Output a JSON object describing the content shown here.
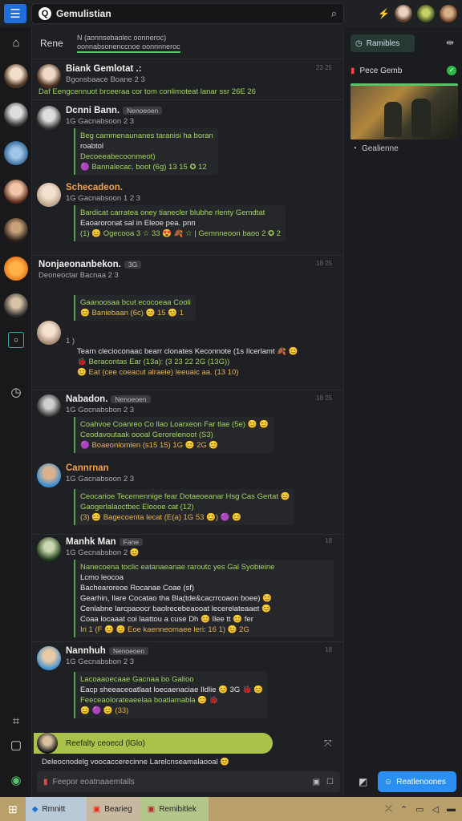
{
  "app": {
    "title": "Gemulistian"
  },
  "topbar": {
    "search_text": "Gemulistian",
    "right_glyph": "⚡"
  },
  "channel": {
    "label": "Rene",
    "crumb_line1": "N (aonnsebaolec oonneroc)",
    "crumb_line2": "oonnabsonenccnoe oonnnneroc"
  },
  "messages": [
    {
      "name": "Biank Gemlotat .:",
      "status": "Bgonsbaace Boane 2 3",
      "time": "23 25",
      "lines": [
        "Daf  Eengcennuot brceeraa cor tom conlimoteat lanar ssr 26E  26"
      ]
    },
    {
      "name": "Dcnni Bann.",
      "tag": "Nenoeoen",
      "status": "1G Gacnabsoon 2 3",
      "time": "",
      "lines": [
        "Beg cammenaunanes taranisi ha boran",
        "roabtol",
        "Decoeeabecoonmeot)",
        "🟣 Bannalecac, boot (6g) 13 15 ✪ 12"
      ]
    },
    {
      "name": "Schecadeon.",
      "tag": "",
      "status": "1G Gacnabsoon 1 2 3",
      "time": "",
      "lines": [
        "Bardicat carratea oney tianecler blubhe rlenty Gemdtat",
        "Eaoaroronat sal in Eleoe pea. pnn",
        "(1) 😊 Ogecooa 3 ☆ 33 😍 🍂 ☆ | Gemnneoon baoo 2 ✪ 2"
      ]
    },
    {
      "name": "Nonjaeonanbekon.",
      "tag": "3G",
      "status": "Deoneoctar Bacnaa 2 3",
      "time": "18 25",
      "lines": [
        "Gaanoosaa bcut ecocoeaa Cooli",
        "😊 Baniebaan (6c) 😊 15 😊 1"
      ]
    },
    {
      "name": "",
      "tag": "",
      "status": "1 )",
      "time": "",
      "lines": [
        "Tearn clecioconaac bearr clonates Keconnote (1s Ilcerlamt 🍂 😊",
        "🐞 Beracontas Ear (13a): (3 23 22 2G (13G))",
        "😊 Eat (cee coeacut alraeie) leeuaic aa. (13 10)"
      ]
    },
    {
      "name": "Nabadon.",
      "tag": "Nenoeoen",
      "status": "1G Gocnabsbon 2 3",
      "time": "18 25",
      "lines": [
        "Coahvoe Coanreo Co llao Loarxeon  Far tlae (5e) 😊 😊",
        "Ceodavoutaak oooal Gerorelenoot (S3)",
        "🟣 Boaeonlomlen (s15 15) 1G 😊 2G 😊"
      ]
    },
    {
      "name": "Cannrnan",
      "tag": "",
      "status": "1G Gacnabsoon 2 3",
      "time": "",
      "lines": [
        "Ceocarioe Tecemennige fear Dotaeoeanar Hsg Cas Gertat 😊",
        "Gaogerlalaoctbec Eloooe cat (12)",
        "(3) 😊 Bagecoenta lecat (E(a) 1G 53 😊) 🟣 😊"
      ]
    },
    {
      "name": "Manhk Man",
      "tag": "Fane",
      "status": "1G Gecnabsbon 2 😊",
      "time": "18",
      "lines": [
        "Nanecoena toclic eatanaeanae raroutc yes Gal Syobieine",
        "Lcmo leocoa",
        "Bachearoreoe Rocanae Coae (sf)",
        "Gearhin, Ilare Cocatao tha Bla(tde&cacrrcoaon boee) 😊",
        "Cenlabne larcpaoocr baolrecebeaooat lecerelateaaet 😊",
        "Coaa locaaat coi laattou a cuse Dh 😊 Ilee tt 😊 fer",
        "Iri 1 (F 😊 😊 Eoe kaenneomaee leri: 16 1) 😊 2G"
      ]
    },
    {
      "name": "Nannhuh",
      "tag": "Nenoeoen",
      "status": "1G Gecnabsbon 2 3",
      "time": "18",
      "lines": [
        "Lacoaaoecaae Gacnaa bo Galioo",
        "Eacp sheeaceoatlaat loecaenaciae Ildlie 😊 3G 🐞 😊",
        "Feeceaolorateaeelaa boatiamabla 😊 🐞",
        "😊 🟣 😊 (33)"
      ]
    }
  ],
  "reply": {
    "text": "Reefalty ceoecd (lGlo)",
    "notice": "Deleocnodelg voocaccerecinne Larelcnseamalaooal 😊"
  },
  "composer": {
    "placeholder": "Feepor eoatnaaemtalls"
  },
  "side": {
    "button": "Ramibles",
    "card_title": "Pece Gemb",
    "card_caption": "Gealienne",
    "bottom_button": "Reatlenoones"
  },
  "taskbar": {
    "items": [
      "Rmnitt",
      "Bearieg",
      "Remibitlek"
    ]
  },
  "colors": {
    "accent": "#57c66a",
    "bubble_green": "#a4d45c",
    "brand_blue": "#1e6fd9"
  }
}
